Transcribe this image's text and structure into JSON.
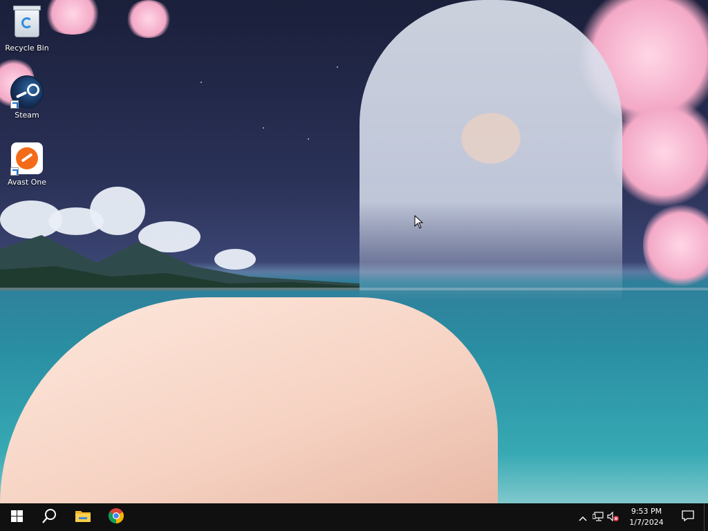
{
  "desktop": {
    "icons": [
      {
        "label": "Recycle Bin",
        "icon": "recycle-bin-icon"
      },
      {
        "label": "Steam",
        "icon": "steam-icon"
      },
      {
        "label": "Avast One",
        "icon": "avast-one-icon"
      }
    ]
  },
  "taskbar": {
    "start": {
      "icon": "windows-start-icon"
    },
    "search": {
      "icon": "search-icon"
    },
    "pinned": [
      {
        "icon": "file-explorer-icon"
      },
      {
        "icon": "chrome-icon"
      }
    ],
    "tray": {
      "icons": [
        "chevron-up-icon",
        "network-icon",
        "volume-muted-icon"
      ],
      "time": "9:53 PM",
      "date": "1/7/2024",
      "notifications_icon": "action-center-icon"
    }
  },
  "colors": {
    "taskbar_bg": "#101010",
    "accent_orange": "#f36b19",
    "steam_blue": "#16325c"
  }
}
